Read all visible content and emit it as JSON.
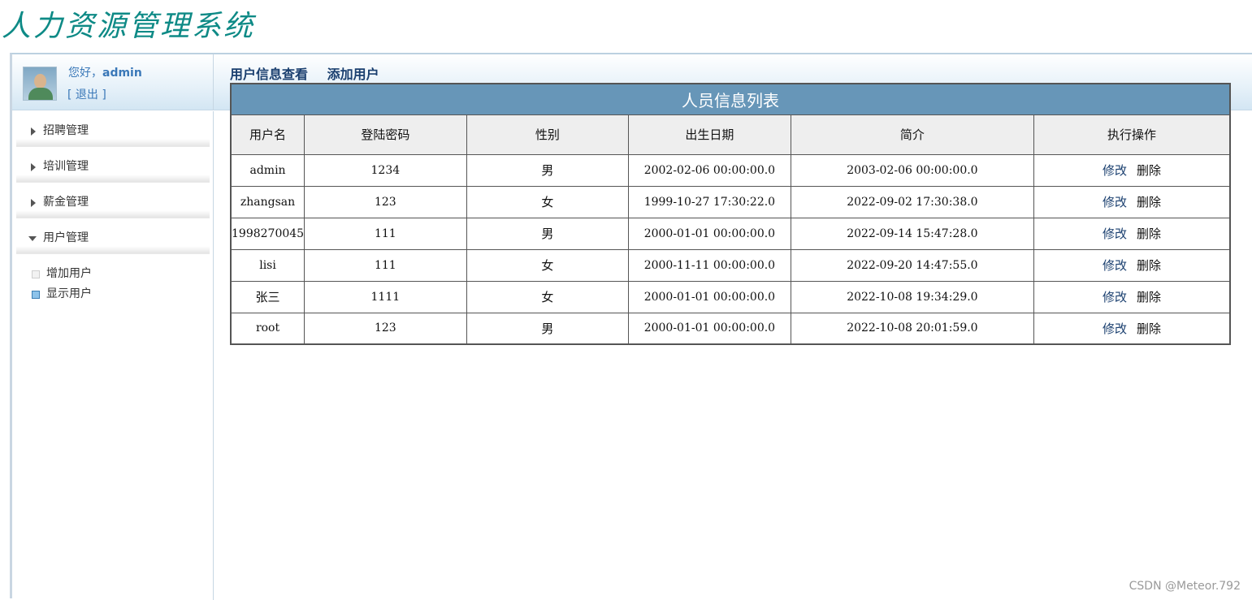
{
  "app": {
    "title": "人力资源管理系统"
  },
  "user": {
    "greeting": "您好，",
    "name": "admin",
    "logout": "[ 退出 ]"
  },
  "sidebar": {
    "items": [
      {
        "label": "招聘管理",
        "expanded": false
      },
      {
        "label": "培训管理",
        "expanded": false
      },
      {
        "label": "薪金管理",
        "expanded": false
      },
      {
        "label": "用户管理",
        "expanded": true
      }
    ],
    "subitems": [
      {
        "label": "增加用户",
        "active": false
      },
      {
        "label": "显示用户",
        "active": true
      }
    ]
  },
  "content": {
    "links": [
      "用户信息查看",
      "添加用户"
    ],
    "table": {
      "caption": "人员信息列表",
      "headers": [
        "用户名",
        "登陆密码",
        "性别",
        "出生日期",
        "简介",
        "执行操作"
      ],
      "rows": [
        {
          "username": "admin",
          "password": "1234",
          "gender": "男",
          "birth": "2002-02-06 00:00:00.0",
          "intro": "2003-02-06 00:00:00.0"
        },
        {
          "username": "zhangsan",
          "password": "123",
          "gender": "女",
          "birth": "1999-10-27 17:30:22.0",
          "intro": "2022-09-02 17:30:38.0"
        },
        {
          "username": "1998270045",
          "password": "111",
          "gender": "男",
          "birth": "2000-01-01 00:00:00.0",
          "intro": "2022-09-14 15:47:28.0"
        },
        {
          "username": "lisi",
          "password": "111",
          "gender": "女",
          "birth": "2000-11-11 00:00:00.0",
          "intro": "2022-09-20 14:47:55.0"
        },
        {
          "username": "张三",
          "password": "1111",
          "gender": "女",
          "birth": "2000-01-01 00:00:00.0",
          "intro": "2022-10-08 19:34:29.0"
        },
        {
          "username": "root",
          "password": "123",
          "gender": "男",
          "birth": "2000-01-01 00:00:00.0",
          "intro": "2022-10-08 20:01:59.0"
        }
      ],
      "actions": {
        "edit": "修改",
        "delete": "删除"
      }
    }
  },
  "watermark": "CSDN @Meteor.792",
  "colors": {
    "title": "#0e8a86",
    "caption_bg": "#6796b8",
    "link": "#1a3f6f",
    "user": "#3a78b8"
  }
}
